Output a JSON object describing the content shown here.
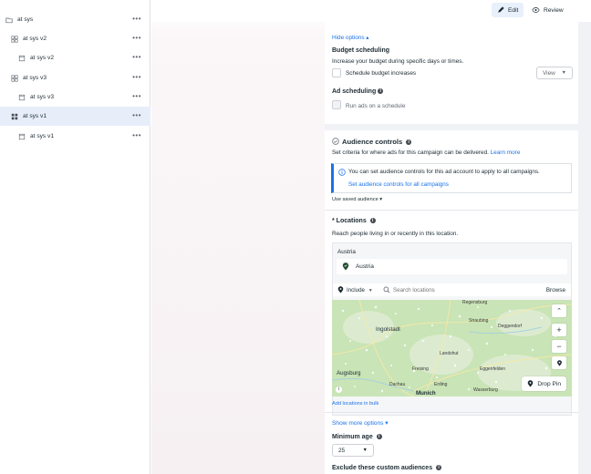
{
  "sidebar": {
    "items": [
      {
        "label": "at sys",
        "icon": "folder-icon",
        "level": 0,
        "selected": false
      },
      {
        "label": "at sys v2",
        "icon": "grid-icon",
        "level": 1,
        "selected": false
      },
      {
        "label": "at sys v2",
        "icon": "page-icon",
        "level": 2,
        "selected": false
      },
      {
        "label": "at sys v3",
        "icon": "grid-icon",
        "level": 1,
        "selected": false
      },
      {
        "label": "at sys v3",
        "icon": "page-icon",
        "level": 2,
        "selected": false
      },
      {
        "label": "at sys v1",
        "icon": "grid-filled-icon",
        "level": 1,
        "selected": true
      },
      {
        "label": "at sys v1",
        "icon": "page-icon",
        "level": 2,
        "selected": false
      }
    ],
    "more_label": "•••"
  },
  "topbar": {
    "edit_label": "Edit",
    "review_label": "Review"
  },
  "budget": {
    "hide_options": "Hide options ▴",
    "title": "Budget scheduling",
    "desc": "Increase your budget during specific days or times.",
    "checkbox_label": "Schedule budget increases",
    "view_label": "View"
  },
  "ad_scheduling": {
    "title": "Ad scheduling",
    "checkbox_label": "Run ads on a schedule"
  },
  "audience": {
    "title": "Audience controls",
    "desc": "Set criteria for where ads for this campaign can be delivered.",
    "learn_more": "Learn more",
    "notice_text": "You can set audience controls for this ad account to apply to all campaigns.",
    "notice_link": "Set audience controls for all campaigns",
    "use_saved": "Use saved audience ▾"
  },
  "locations": {
    "title": "* Locations",
    "desc": "Reach people living in or recently in this location.",
    "country_header": "Austria",
    "selected_location": "Austria",
    "include_label": "Include",
    "search_placeholder": "Search locations",
    "browse_label": "Browse",
    "add_bulk": "Add locations in bulk",
    "drop_pin": "Drop Pin"
  },
  "map": {
    "cities": [
      {
        "name": "Ingolstadt",
        "big": true
      },
      {
        "name": "Augsburg",
        "big": true
      },
      {
        "name": "Munich",
        "big": true
      },
      {
        "name": "Regensburg",
        "big": false
      },
      {
        "name": "Straubing",
        "big": false
      },
      {
        "name": "Deggendorf",
        "big": false
      },
      {
        "name": "Landshut",
        "big": false
      },
      {
        "name": "Freising",
        "big": false
      },
      {
        "name": "Dachau",
        "big": false
      },
      {
        "name": "Eggenfelden",
        "big": false
      },
      {
        "name": "Erding",
        "big": false
      },
      {
        "name": "Wasserburg",
        "big": false
      }
    ],
    "colors": {
      "land": "#c9e4b6",
      "urban": "#ffffff",
      "roads": "#f5e9a8"
    }
  },
  "more_options": "Show more options ▾",
  "min_age": {
    "title": "Minimum age",
    "value": "25"
  },
  "exclude": {
    "title": "Exclude these custom audiences"
  },
  "colors": {
    "accent": "#1a73e8",
    "selected_row": "#e7eef9",
    "panel_bg": "#f0f2f5"
  }
}
